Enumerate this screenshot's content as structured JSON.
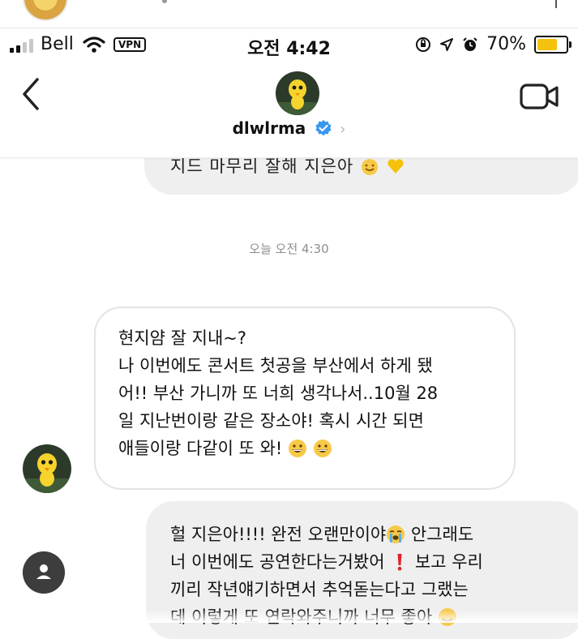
{
  "status_bar": {
    "carrier": "Bell",
    "vpn_label": "VPN",
    "time": "오전 4:42",
    "battery_percent": "70%",
    "battery_level": 0.7,
    "battery_color": "#f4c20d",
    "icons": [
      "signal-icon",
      "wifi-icon",
      "vpn-badge",
      "orientation-lock-icon",
      "location-arrow-icon",
      "alarm-icon",
      "battery-icon"
    ]
  },
  "header": {
    "username": "dlwlrma",
    "verified_color": "#3897f0",
    "chevron": "›",
    "back_icon": "chevron-left-icon",
    "video_icon": "video-camera-icon"
  },
  "messages": {
    "previous_partial": "지드 마무리 잘해 지은아",
    "timestamp": "오늘 오전 4:30",
    "received": {
      "lines": [
        "현지얌 잘 지내~?",
        "나 이번에도 콘서트 첫공을 부산에서 하게 됐",
        "어!! 부산 가니까 또 너희 생각나서..10월 28",
        "일 지난번이랑 같은 장소야! 혹시 시간 되면",
        "애들이랑 다같이 또 와!"
      ]
    },
    "sent": {
      "line1": "헐 지은아!!!! 완전 오랜만이야",
      "line1_tail": " 안그래도",
      "line2": "너 이번에도 공연한다는거봤어",
      "line2_tail": " 보고 우리",
      "line3": "끼리 작년얘기하면서 추억돋는다고  그랬는",
      "line4": "데 이렇게 또 연락와주니까 너무 좋아"
    }
  }
}
